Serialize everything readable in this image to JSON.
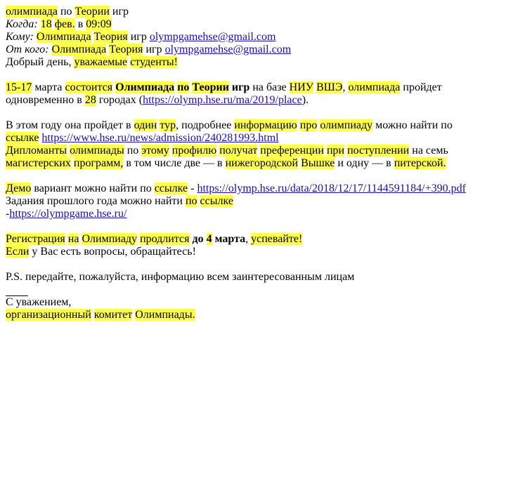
{
  "colors": {
    "highlight": "#ffff4c",
    "link": "#1a0dab",
    "text": "#000000"
  },
  "header": {
    "subject": [
      {
        "t": "олимпиада",
        "hl": true
      },
      {
        "t": " по ",
        "hl": false
      },
      {
        "t": "Теории",
        "hl": true
      },
      {
        "t": " игр",
        "hl": false
      }
    ],
    "when_label": "Когда:",
    "when": [
      {
        "t": " ",
        "hl": false
      },
      {
        "t": "18",
        "hl": true
      },
      {
        "t": " ",
        "hl": false
      },
      {
        "t": "фев.",
        "hl": true
      },
      {
        "t": " в ",
        "hl": false
      },
      {
        "t": "09:09",
        "hl": true
      }
    ],
    "to_label": "Кому:",
    "to": [
      {
        "t": " ",
        "hl": false
      },
      {
        "t": "Олимпиада",
        "hl": true
      },
      {
        "t": " ",
        "hl": false
      },
      {
        "t": "Теория",
        "hl": true
      },
      {
        "t": " игр ",
        "hl": false
      },
      {
        "t": "olympgamehse@gmail.com",
        "link": true
      }
    ],
    "from_label": "От кого:",
    "from": [
      {
        "t": " ",
        "hl": false
      },
      {
        "t": "Олимпиада",
        "hl": true
      },
      {
        "t": " ",
        "hl": false
      },
      {
        "t": "Теория",
        "hl": true
      },
      {
        "t": " игр ",
        "hl": false
      },
      {
        "t": "olympgamehse@gmail.com",
        "link": true
      }
    ]
  },
  "body": {
    "greeting": [
      {
        "t": "Добрый день, ",
        "hl": false
      },
      {
        "t": "уважаемые",
        "hl": true
      },
      {
        "t": " ",
        "hl": false
      },
      {
        "t": "студенты!",
        "hl": true
      }
    ],
    "p1_l1": [
      {
        "t": "15-17",
        "hl": true
      },
      {
        "t": " марта ",
        "hl": false
      },
      {
        "t": "состоится",
        "hl": true
      },
      {
        "t": " ",
        "hl": false
      },
      {
        "t": "Олимпиада",
        "hl": true,
        "b": true
      },
      {
        "t": " ",
        "hl": false,
        "b": true
      },
      {
        "t": "по",
        "hl": true,
        "b": true
      },
      {
        "t": " ",
        "hl": false,
        "b": true
      },
      {
        "t": "Теории",
        "hl": true,
        "b": true
      },
      {
        "t": " игр",
        "hl": false,
        "b": true
      },
      {
        "t": " на базе ",
        "hl": false
      },
      {
        "t": "НИУ",
        "hl": true
      },
      {
        "t": " ",
        "hl": false
      },
      {
        "t": "ВШЭ",
        "hl": true
      },
      {
        "t": ", ",
        "hl": false
      },
      {
        "t": "олимпиада",
        "hl": true
      },
      {
        "t": " пройдет",
        "hl": false
      }
    ],
    "p1_l2": [
      {
        "t": "одновременно в ",
        "hl": false
      },
      {
        "t": "28",
        "hl": true
      },
      {
        "t": " городах (",
        "hl": false
      },
      {
        "t": "https://olymp.hse.ru/ma/2019/place",
        "link": true
      },
      {
        "t": ").",
        "hl": false
      }
    ],
    "p2_l1": [
      {
        "t": "В этом году она пройдет в ",
        "hl": false
      },
      {
        "t": "один",
        "hl": true
      },
      {
        "t": " ",
        "hl": false
      },
      {
        "t": "тур",
        "hl": true
      },
      {
        "t": ", подробнее ",
        "hl": false
      },
      {
        "t": "информацию",
        "hl": true
      },
      {
        "t": " ",
        "hl": false
      },
      {
        "t": "про",
        "hl": true
      },
      {
        "t": " ",
        "hl": false
      },
      {
        "t": "олимпиаду",
        "hl": true
      },
      {
        "t": " можно найти по",
        "hl": false
      }
    ],
    "p2_l2": [
      {
        "t": "ссылке",
        "hl": true
      },
      {
        "t": " ",
        "hl": false
      },
      {
        "t": "https://www.hse.ru/news/admission/240281993.html",
        "link": true
      }
    ],
    "p2_l3": [
      {
        "t": "Дипломанты",
        "hl": true
      },
      {
        "t": " ",
        "hl": false
      },
      {
        "t": "олимпиады",
        "hl": true
      },
      {
        "t": " по ",
        "hl": false
      },
      {
        "t": "этому",
        "hl": true
      },
      {
        "t": " ",
        "hl": false
      },
      {
        "t": "профилю",
        "hl": true
      },
      {
        "t": " ",
        "hl": false
      },
      {
        "t": "получат",
        "hl": true
      },
      {
        "t": " ",
        "hl": false
      },
      {
        "t": "преференции",
        "hl": true
      },
      {
        "t": " ",
        "hl": false
      },
      {
        "t": "при",
        "hl": true
      },
      {
        "t": " ",
        "hl": false
      },
      {
        "t": "поступлении",
        "hl": true
      },
      {
        "t": " на семь",
        "hl": false
      }
    ],
    "p2_l4": [
      {
        "t": "магистерских",
        "hl": true
      },
      {
        "t": " ",
        "hl": false
      },
      {
        "t": "программ,",
        "hl": true
      },
      {
        "t": " в том числе две — в ",
        "hl": false
      },
      {
        "t": "нижегородской",
        "hl": true
      },
      {
        "t": " ",
        "hl": false
      },
      {
        "t": "Вышке",
        "hl": true
      },
      {
        "t": " и одну — в ",
        "hl": false
      },
      {
        "t": "питерской.",
        "hl": true
      }
    ],
    "p3_l1": [
      {
        "t": "Демо",
        "hl": true
      },
      {
        "t": " вариант можно найти по ",
        "hl": false
      },
      {
        "t": "ссылке",
        "hl": true
      },
      {
        "t": " - ",
        "hl": false
      },
      {
        "t": "https://olymp.hse.ru/data/2018/12/17/1144591184/+390.pdf",
        "link": true
      }
    ],
    "p3_l2": [
      {
        "t": "Задания прошлого года можно найти ",
        "hl": false
      },
      {
        "t": "по",
        "hl": true
      },
      {
        "t": " ",
        "hl": false
      },
      {
        "t": "ссылке",
        "hl": true
      }
    ],
    "p3_l3": [
      {
        "t": " -",
        "hl": false
      },
      {
        "t": "https://olympgame.hse.ru/",
        "link": true
      }
    ],
    "p4_l1": [
      {
        "t": "Регистрация",
        "hl": true
      },
      {
        "t": " ",
        "hl": false
      },
      {
        "t": "на",
        "hl": true
      },
      {
        "t": " ",
        "hl": false
      },
      {
        "t": "Олимпиаду",
        "hl": true
      },
      {
        "t": " ",
        "hl": false
      },
      {
        "t": "продлится",
        "hl": true
      },
      {
        "t": " ",
        "hl": false
      },
      {
        "t": "до",
        "hl": false,
        "b": true
      },
      {
        "t": " ",
        "hl": false,
        "b": true
      },
      {
        "t": "4",
        "hl": true,
        "b": true
      },
      {
        "t": " марта",
        "hl": false,
        "b": true
      },
      {
        "t": ", ",
        "hl": false
      },
      {
        "t": "успевайте!",
        "hl": true
      }
    ],
    "p4_l2": [
      {
        "t": "Если",
        "hl": true
      },
      {
        "t": " у Вас есть вопросы, обращайтесь!",
        "hl": false
      }
    ],
    "ps": [
      {
        "t": "P.S. передайте, пожалуйста, информацию всем заинтересованным лицам",
        "hl": false
      }
    ],
    "sign_l1": [
      {
        "t": "С уважением,",
        "hl": false
      }
    ],
    "sign_l2": [
      {
        "t": "организационный",
        "hl": true
      },
      {
        "t": " ",
        "hl": false
      },
      {
        "t": "комитет",
        "hl": true
      },
      {
        "t": " ",
        "hl": false
      },
      {
        "t": "Олимпиады.",
        "hl": true
      }
    ]
  }
}
